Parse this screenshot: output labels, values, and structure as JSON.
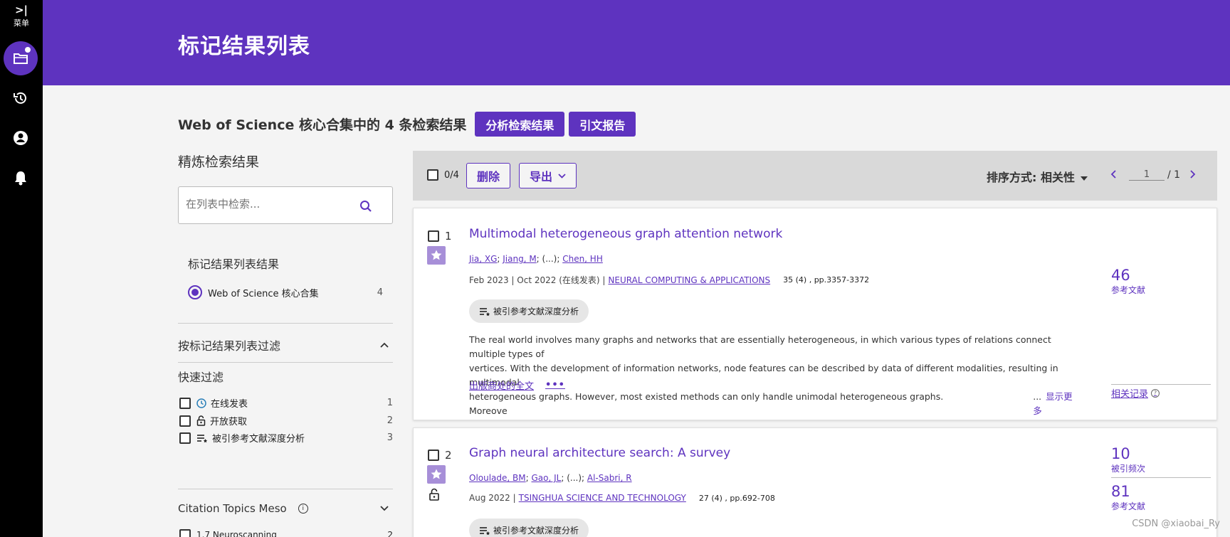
{
  "rail": {
    "expand_glyph": ">|",
    "menu_label": "菜单",
    "icons": [
      "folder-icon",
      "history-icon",
      "user-icon",
      "bell-icon"
    ]
  },
  "header": {
    "title": "标记结果列表"
  },
  "results": {
    "heading": "Web of Science 核心合集中的 4 条检索结果",
    "analyze_label": "分析检索结果",
    "citation_report_label": "引文报告"
  },
  "refine": {
    "title": "精炼检索结果",
    "search_placeholder": "在列表中检索...",
    "marked_title": "标记结果列表结果",
    "wos_label": "Web of Science 核心合集",
    "wos_count": "4",
    "filter_title": "按标记结果列表过滤",
    "quick_title": "快速过滤",
    "quick_filters": [
      {
        "label": "在线发表",
        "count": "1",
        "icon": "clock-icon"
      },
      {
        "label": "开放获取",
        "count": "2",
        "icon": "lock-open-icon"
      },
      {
        "label": "被引参考文献深度分析",
        "count": "3",
        "icon": "list-star-icon"
      }
    ],
    "topics_title": "Citation Topics Meso",
    "info_glyph": "i",
    "topic_row": {
      "label": "1.7 Neuroscanning",
      "count": "2"
    }
  },
  "toolbar": {
    "selected": "0/4",
    "delete_label": "删除",
    "export_label": "导出",
    "sort_label": "排序方式: 相关性",
    "page_value": "1",
    "page_total": "/ 1"
  },
  "records": [
    {
      "number": "1",
      "title": "Multimodal heterogeneous graph attention network",
      "authors": [
        "Jia, XG",
        "Jiang, M",
        "(...)",
        "Chen, HH"
      ],
      "date": "Feb 2023 | Oct 2022 (在线发表) |",
      "journal": "NEURAL COMPUTING & APPLICATIONS",
      "volume": "35 (4) , pp.3357-3372",
      "chip_label": "被引参考文献深度分析",
      "abstract_lines": [
        "The real world involves many graphs and networks that are essentially heterogeneous, in which various types of relations connect multiple types of",
        "vertices. With the development of information networks, node features can be described by data of different modalities, resulting in multimodal",
        "heterogeneous graphs. However, most existed methods can only handle unimodal heterogeneous graphs. Moreove"
      ],
      "ellipsis": "...",
      "show_more": "显示更多",
      "fulltext_label": "出版商处的全文",
      "more_dots": "•••",
      "metric_value": "46",
      "metric_label": "参考文献",
      "related_label": "相关记录",
      "help_glyph": "?"
    },
    {
      "number": "2",
      "title": "Graph neural architecture search: A survey",
      "authors": [
        "Oloulade, BM",
        "Gao, JL",
        "(...)",
        "Al-Sabri, R"
      ],
      "date": "Aug 2022 |",
      "journal": "TSINGHUA SCIENCE AND TECHNOLOGY",
      "volume": "27 (4) , pp.692-708",
      "chip_label": "被引参考文献深度分析",
      "metric1_value": "10",
      "metric1_label": "被引频次",
      "metric2_value": "81",
      "metric2_label": "参考文献"
    }
  ],
  "watermark": "CSDN @xiaobai_Ry",
  "colors": {
    "accent": "#5e33bf",
    "rail": "#000000",
    "star": "#a78fd8"
  }
}
